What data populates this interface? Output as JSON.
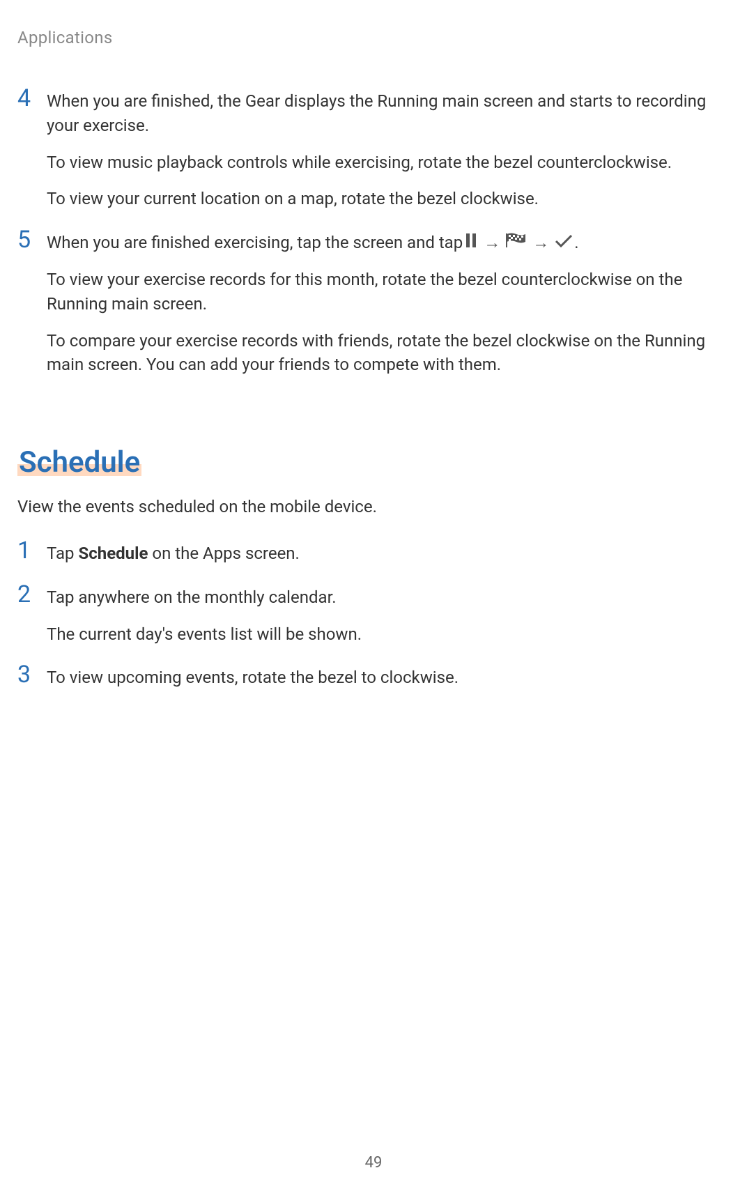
{
  "header": {
    "title": "Applications"
  },
  "section1": {
    "step4": {
      "number": "4",
      "p1": "When you are finished, the Gear displays the Running main screen and starts to recording your exercise.",
      "p2": "To view music playback controls while exercising, rotate the bezel counterclockwise.",
      "p3": "To view your current location on a map, rotate the bezel clockwise."
    },
    "step5": {
      "number": "5",
      "p1_prefix": "When you are finished exercising, tap the screen and tap ",
      "arrow1": "→",
      "arrow2": "→",
      "p1_suffix": ".",
      "p2": "To view your exercise records for this month, rotate the bezel counterclockwise on the Running main screen.",
      "p3": "To compare your exercise records with friends, rotate the bezel clockwise on the Running main screen. You can add your friends to compete with them."
    }
  },
  "section2": {
    "heading": "Schedule",
    "intro": "View the events scheduled on the mobile device.",
    "step1": {
      "number": "1",
      "p1_prefix": "Tap ",
      "p1_bold": "Schedule",
      "p1_suffix": " on the Apps screen."
    },
    "step2": {
      "number": "2",
      "p1": "Tap anywhere on the monthly calendar.",
      "p2": "The current day's events list will be shown."
    },
    "step3": {
      "number": "3",
      "p1": "To view upcoming events, rotate the bezel to clockwise."
    }
  },
  "pageNumber": "49"
}
